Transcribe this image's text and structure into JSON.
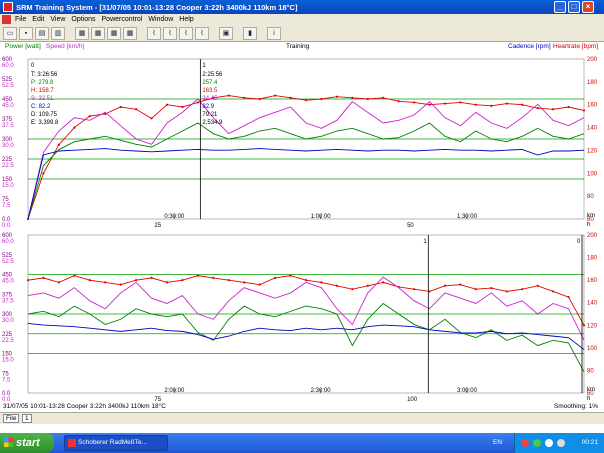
{
  "window": {
    "title": "SRM Training System - [31/07/05 10:01-13:28 Cooper 3:22h 3400kJ 110km 18°C]",
    "minimize": "_",
    "maximize": "□",
    "close": "×"
  },
  "menu": [
    "File",
    "Edit",
    "View",
    "Options",
    "Powercontrol",
    "Window",
    "Help"
  ],
  "toolbar_icons": [
    "open-icon",
    "save-icon",
    "print-icon",
    "print-preview-icon",
    "layout-1-icon",
    "layout-2-icon",
    "layout-3-icon",
    "layout-4-icon",
    "chart-1-icon",
    "chart-2-icon",
    "chart-3-icon",
    "chart-4-icon",
    "calculator-icon",
    "bar-chart-icon",
    "info-icon"
  ],
  "header": {
    "power_label": "Power [watt]",
    "speed_label": "Speed [km/h]",
    "center_label": "Training",
    "cadence_label": "Cadence [rpm]",
    "heartrate_label": "Heartrate [bpm]"
  },
  "chart_data": [
    {
      "type": "line",
      "left_axis_power": [
        "600",
        "525",
        "450",
        "375",
        "300",
        "225",
        "150",
        "75",
        "0.0"
      ],
      "left_axis_speed": [
        "60.0",
        "52.5",
        "45.0",
        "37.5",
        "30.0",
        "22.5",
        "15.0",
        "7.5",
        "0.0"
      ],
      "right_axis_hr": [
        "200",
        "180",
        "160",
        "140",
        "120",
        "100",
        "80",
        "60"
      ],
      "x_time_labels": [
        "0:30:00",
        "1:00:00",
        "1:30:00"
      ],
      "x_km_labels": [
        "25",
        "50"
      ],
      "x_km_unit": "km",
      "x_time_unit": "h",
      "cursor1": {
        "label": "0",
        "lines": [
          "T: 3:26:56",
          "P: 279.8",
          "H: 158.7",
          "S: 32.51",
          "C: 82.2",
          "D: 109.75",
          "E: 3,399.8"
        ]
      },
      "cursor2": {
        "label": "1",
        "lines": [
          "2:25:56",
          "257.4",
          "163.5",
          "34.45",
          "82.9",
          "79.21",
          "2,534.9"
        ]
      },
      "series": [
        {
          "name": "Heartrate [bpm]",
          "color": "#e00000",
          "unit": "bpm",
          "values": [
            60,
            100,
            125,
            140,
            150,
            152,
            158,
            156,
            148,
            160,
            158,
            162,
            166,
            168,
            166,
            165,
            168,
            166,
            164,
            165,
            167,
            166,
            165,
            166,
            163,
            162,
            160,
            161,
            162,
            160,
            159,
            161,
            160,
            157,
            156,
            158,
            155
          ]
        },
        {
          "name": "Speed [km/h]",
          "color": "#d020d0",
          "unit": "km/h",
          "values": [
            0,
            25,
            33,
            38,
            37,
            40,
            35,
            30,
            28,
            36,
            40,
            45,
            38,
            32,
            35,
            38,
            40,
            42,
            36,
            34,
            37,
            44,
            40,
            36,
            37,
            39,
            44,
            38,
            35,
            40,
            36,
            34,
            38,
            43,
            37,
            35,
            38
          ]
        },
        {
          "name": "Power [watt]",
          "color": "#008000",
          "unit": "watt",
          "values": [
            0,
            200,
            260,
            290,
            300,
            310,
            295,
            280,
            270,
            300,
            330,
            360,
            320,
            300,
            310,
            330,
            340,
            320,
            300,
            310,
            330,
            340,
            320,
            300,
            305,
            330,
            360,
            310,
            290,
            330,
            300,
            290,
            310,
            340,
            310,
            300,
            320
          ]
        },
        {
          "name": "Cadence [rpm]",
          "color": "#0000c0",
          "unit": "rpm",
          "values": [
            0,
            80,
            85,
            86,
            87,
            88,
            86,
            85,
            84,
            85,
            86,
            87,
            86,
            86,
            87,
            88,
            87,
            86,
            85,
            86,
            87,
            86,
            85,
            86,
            86,
            85,
            86,
            87,
            86,
            86,
            85,
            86,
            87,
            80,
            85,
            85,
            86
          ]
        }
      ]
    },
    {
      "type": "line",
      "left_axis_power": [
        "600",
        "525",
        "450",
        "375",
        "300",
        "225",
        "150",
        "75",
        "0.0"
      ],
      "left_axis_speed": [
        "60.0",
        "52.5",
        "45.0",
        "37.5",
        "30.0",
        "22.5",
        "15.0",
        "7.5",
        "0.0"
      ],
      "right_axis_hr": [
        "200",
        "180",
        "160",
        "140",
        "120",
        "100",
        "80",
        "60"
      ],
      "x_time_labels": [
        "2:00:00",
        "2:30:00",
        "3:00:00"
      ],
      "x_km_labels": [
        "75",
        "100"
      ],
      "x_km_unit": "km",
      "x_time_unit": "h",
      "cursor_labels": [
        "1",
        "0"
      ],
      "series": [
        {
          "name": "Heartrate [bpm]",
          "color": "#e00000",
          "unit": "bpm",
          "values": [
            160,
            162,
            158,
            164,
            160,
            158,
            156,
            160,
            162,
            158,
            160,
            164,
            162,
            160,
            158,
            156,
            162,
            164,
            160,
            158,
            155,
            152,
            155,
            158,
            154,
            152,
            150,
            155,
            156,
            152,
            153,
            150,
            152,
            155,
            150,
            145,
            120
          ]
        },
        {
          "name": "Speed [km/h]",
          "color": "#d020d0",
          "unit": "km/h",
          "values": [
            37,
            38,
            36,
            40,
            35,
            32,
            38,
            42,
            36,
            34,
            37,
            30,
            28,
            35,
            40,
            38,
            36,
            38,
            42,
            40,
            32,
            26,
            38,
            44,
            40,
            35,
            32,
            38,
            36,
            34,
            38,
            33,
            35,
            30,
            34,
            32,
            20
          ]
        },
        {
          "name": "Power [watt]",
          "color": "#008000",
          "unit": "watt",
          "values": [
            300,
            310,
            290,
            330,
            300,
            260,
            280,
            320,
            300,
            290,
            300,
            230,
            200,
            280,
            330,
            300,
            290,
            310,
            330,
            320,
            300,
            180,
            280,
            340,
            300,
            260,
            240,
            280,
            230,
            210,
            240,
            200,
            220,
            180,
            200,
            190,
            80
          ]
        },
        {
          "name": "Cadence [rpm]",
          "color": "#0000c0",
          "unit": "rpm",
          "values": [
            88,
            86,
            85,
            84,
            82,
            80,
            78,
            80,
            82,
            79,
            78,
            74,
            68,
            72,
            78,
            82,
            80,
            79,
            82,
            80,
            82,
            80,
            84,
            86,
            85,
            84,
            80,
            78,
            76,
            76,
            78,
            75,
            76,
            74,
            72,
            70,
            55
          ]
        }
      ]
    }
  ],
  "status": {
    "left": "31/07/05 10:01-13:28 Cooper 3:22h 3400kJ 110km 18°C",
    "right": "Smoothing: 1%"
  },
  "tabs": {
    "file_tab": "File",
    "index_tab": "1"
  },
  "taskbar": {
    "start": "start",
    "task": "Schoberer RadMeßTe...",
    "lang": "EN",
    "clock": "00:21"
  },
  "colors": {
    "heartrate": "#e00000",
    "speed": "#d020d0",
    "power": "#008000",
    "cadence": "#0000c0",
    "grid": "#00a000",
    "axis_left_power": "#800080",
    "axis_right_hr": "#cc0000"
  }
}
